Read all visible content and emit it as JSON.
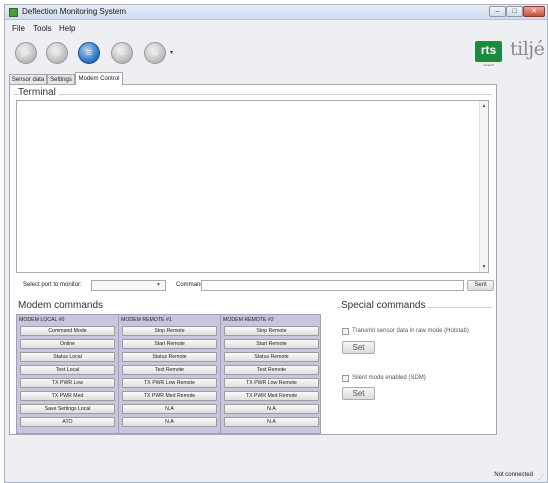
{
  "window": {
    "title": "Deflection Monitoring System",
    "controls": {
      "minimize": "–",
      "maximize": "□",
      "close": "✕"
    }
  },
  "menu": [
    "File",
    "Tools",
    "Help"
  ],
  "toolbar": {
    "buttons": [
      {
        "icon": "disabled-tool-1-icon",
        "glyph": "▶"
      },
      {
        "icon": "disabled-tool-2-icon",
        "glyph": "■"
      },
      {
        "icon": "database-icon",
        "glyph": "≡"
      },
      {
        "icon": "disabled-tool-3-icon",
        "glyph": "●"
      },
      {
        "icon": "disabled-tool-4-icon",
        "glyph": "■"
      }
    ],
    "dropdown_arrow": "▾"
  },
  "logo": {
    "rts": "rts",
    "rts_sub": "norsk tlf",
    "brand": "tiljé"
  },
  "tabs": [
    "Sensor data",
    "Settings",
    "Modem Control"
  ],
  "terminal": {
    "title": "Terminal",
    "select_port_label": "Select port to monitor:",
    "select_port_value": "",
    "command_label": "Command:",
    "command_value": "",
    "send_label": "Sent"
  },
  "modem_commands": {
    "title": "Modem commands",
    "columns": [
      {
        "header": "MODEM LOCAL #0",
        "buttons": [
          "Command Mode",
          "Online",
          "Status Local",
          "Test Local",
          "TX PWR Low",
          "TX PWR Med",
          "Save Settings Local",
          "ATO"
        ]
      },
      {
        "header": "MODEM REMOTE #1",
        "buttons": [
          "Stop Remote",
          "Start Remote",
          "Status Remote",
          "Test Remote",
          "TX PWR Low Remote",
          "TX PWR Med Remote",
          "N.A",
          "N.A"
        ]
      },
      {
        "header": "MODEM REMOTE #2",
        "buttons": [
          "Stop Remote",
          "Start Remote",
          "Status Remote",
          "Test Remote",
          "TX PWR Low Remote",
          "TX PWR Med Remote",
          "N.A",
          "N.A"
        ]
      }
    ]
  },
  "special_commands": {
    "title": "Special commands",
    "hotstab_label": "Transmit sensor data in raw mode (Hotstab)",
    "set1_label": "Set",
    "sdm_label": "Silent mode enabled (SDM)",
    "set2_label": "Set"
  },
  "status": {
    "connection": "Not connected"
  },
  "colors": {
    "brand_green": "#1d8a3e",
    "table_background": "#c8c6de"
  }
}
